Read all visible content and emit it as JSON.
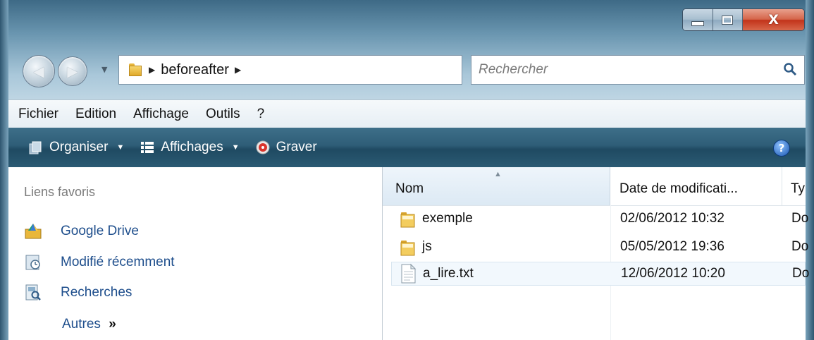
{
  "window": {
    "caption_buttons": {
      "minimize": "minimize",
      "maximize": "maximize",
      "close": "X"
    }
  },
  "navigation": {
    "breadcrumb": [
      "beforeafter"
    ],
    "search_placeholder": "Rechercher"
  },
  "menubar": {
    "items": [
      "Fichier",
      "Edition",
      "Affichage",
      "Outils",
      "?"
    ]
  },
  "commandbar": {
    "organize": "Organiser",
    "views": "Affichages",
    "burn": "Graver"
  },
  "nav_pane": {
    "header": "Liens favoris",
    "links": [
      {
        "label": "Google Drive",
        "icon": "google-drive-icon"
      },
      {
        "label": "Modifié récemment",
        "icon": "recent-icon"
      },
      {
        "label": "Recherches",
        "icon": "searches-icon"
      }
    ],
    "more": "Autres",
    "more_glyph": "»"
  },
  "file_list": {
    "columns": [
      "Nom",
      "Date de modificati...",
      "Ty"
    ],
    "rows": [
      {
        "name": "exemple",
        "date": "02/06/2012 10:32",
        "type": "Do",
        "icon": "folder-icon"
      },
      {
        "name": "js",
        "date": "05/05/2012 19:36",
        "type": "Do",
        "icon": "folder-icon"
      },
      {
        "name": "a_lire.txt",
        "date": "12/06/2012 10:20",
        "type": "Do",
        "icon": "text-file-icon"
      }
    ]
  },
  "colors": {
    "link": "#1e4e8c",
    "command_bar": "#2e5d77",
    "close_button": "#c2331a"
  }
}
